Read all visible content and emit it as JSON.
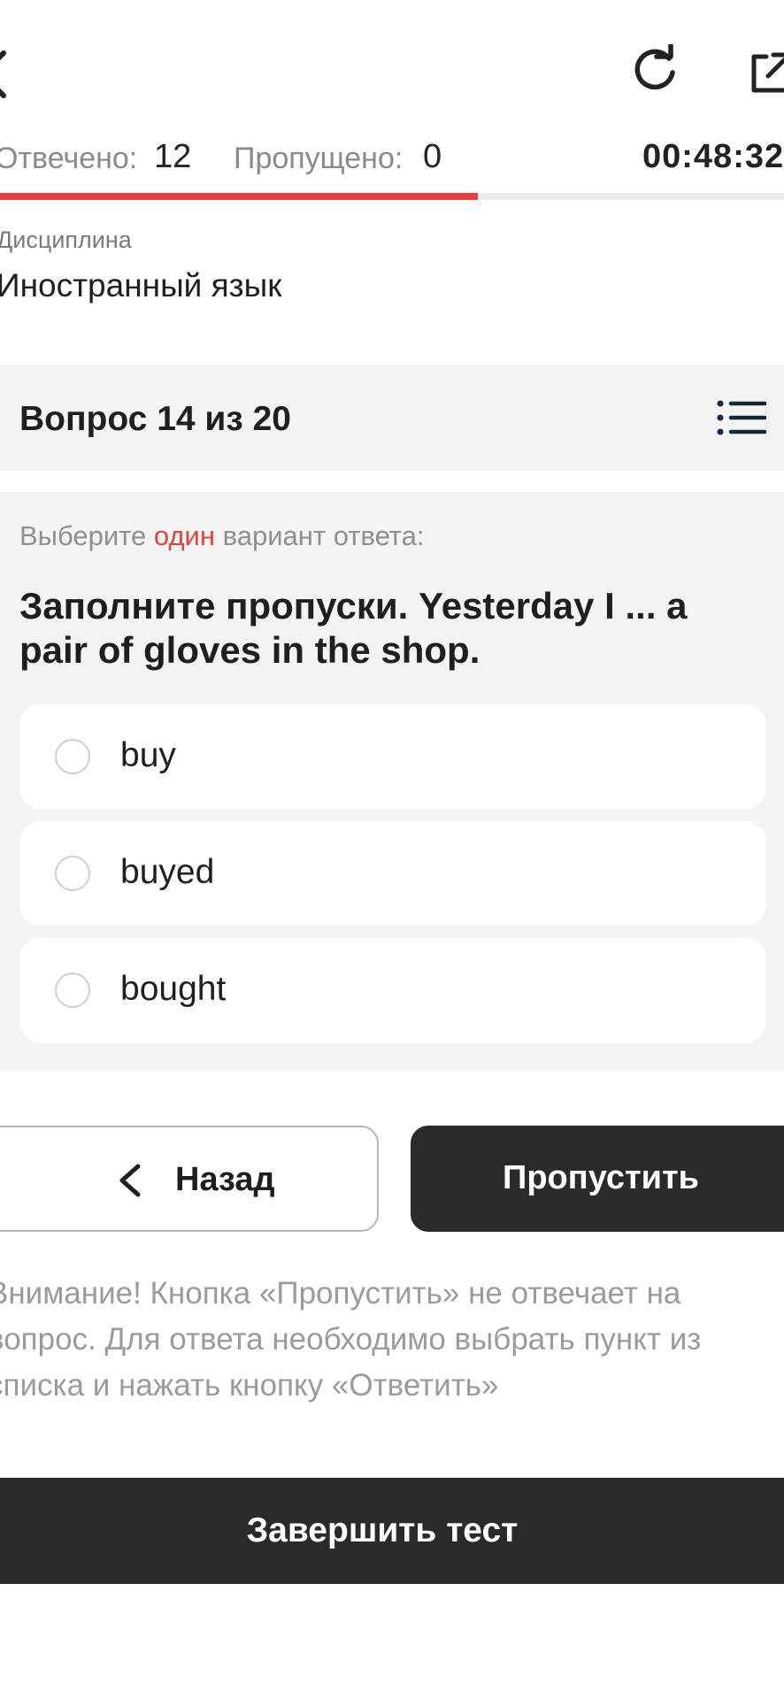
{
  "header": {
    "back_icon": "chevron-left-icon",
    "refresh_icon": "refresh-icon",
    "external_icon": "external-link-icon"
  },
  "status": {
    "answered_label": "Отвечено:",
    "answered_value": "12",
    "skipped_label": "Пропущено:",
    "skipped_value": "0",
    "timer": "00:48:32",
    "progress_fraction": 0.61,
    "progress_color": "#e8403c"
  },
  "discipline": {
    "label": "Дисциплина",
    "value": "Иностранный язык"
  },
  "question_header": {
    "counter": "Вопрос 14 из 20",
    "list_icon": "list-icon"
  },
  "question": {
    "instruction_before": "Выберите",
    "instruction_accent": "один",
    "instruction_after": "вариант ответа:",
    "text": "Заполните пропуски. Yesterday I ... a pair of gloves in the shop.",
    "options": [
      {
        "label": "buy",
        "selected": false
      },
      {
        "label": "buyed",
        "selected": false
      },
      {
        "label": "bought",
        "selected": false
      }
    ]
  },
  "actions": {
    "back_label": "Назад",
    "skip_label": "Пропустить",
    "finish_label": "Завершить тест"
  },
  "warning": "Внимание! Кнопка «Пропустить» не отвечает на вопрос. Для ответа необходимо выбрать пункт из списка и нажать кнопку «Ответить»",
  "colors": {
    "accent": "#e8403c",
    "dark_button": "#2a2a2a",
    "card_bg": "#f4f4f4"
  }
}
